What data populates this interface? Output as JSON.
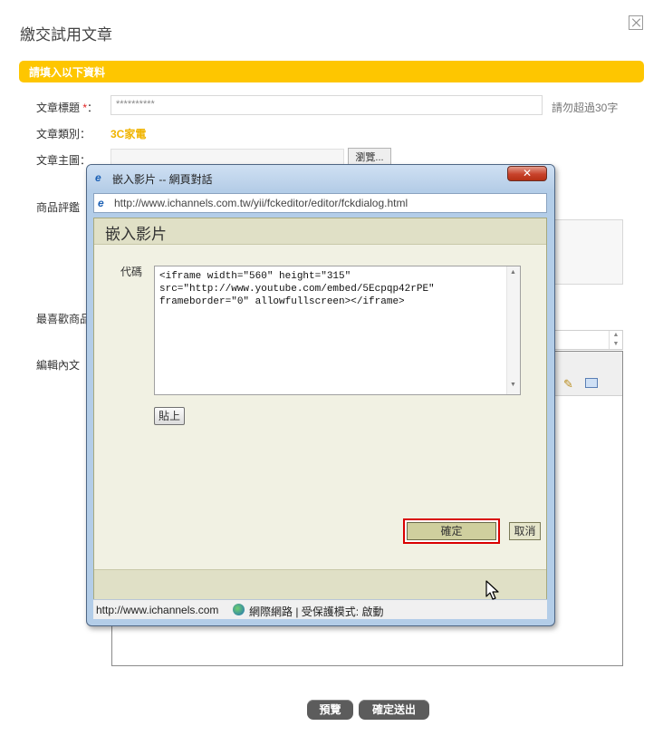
{
  "page": {
    "title": "繳交試用文章",
    "instruction_bar": "請填入以下資料",
    "fields": {
      "article_title_label": "文章標題",
      "required_mark": "*",
      "colon": "：",
      "article_title_value": "**********",
      "article_title_hint": "請勿超過30字",
      "category_label": "文章類別：",
      "category_value": "3C家電",
      "main_image_label": "文章主圖：",
      "browse_label": "瀏覽...",
      "review_label": "商品評鑑",
      "favorite_label": "最喜歡商品",
      "content_label": "編輯內文"
    },
    "buttons": {
      "preview": "預覽",
      "submit": "確定送出"
    }
  },
  "dialog": {
    "window_title": "嵌入影片 -- 網頁對話",
    "close_symbol": "✕",
    "address": "http://www.ichannels.com.tw/yii/fckeditor/editor/fckdialog.html",
    "header": "嵌入影片",
    "code_label": "代碼",
    "code_value": "<iframe width=\"560\" height=\"315\"\nsrc=\"http://www.youtube.com/embed/5Ecpqp42rPE\"\nframeborder=\"0\" allowfullscreen></iframe>",
    "paste_button": "貼上",
    "ok_button": "確定",
    "cancel_button": "取消",
    "status_url": "http://www.ichannels.com",
    "status_zone": "網際網路 | 受保護模式: 啟動"
  }
}
